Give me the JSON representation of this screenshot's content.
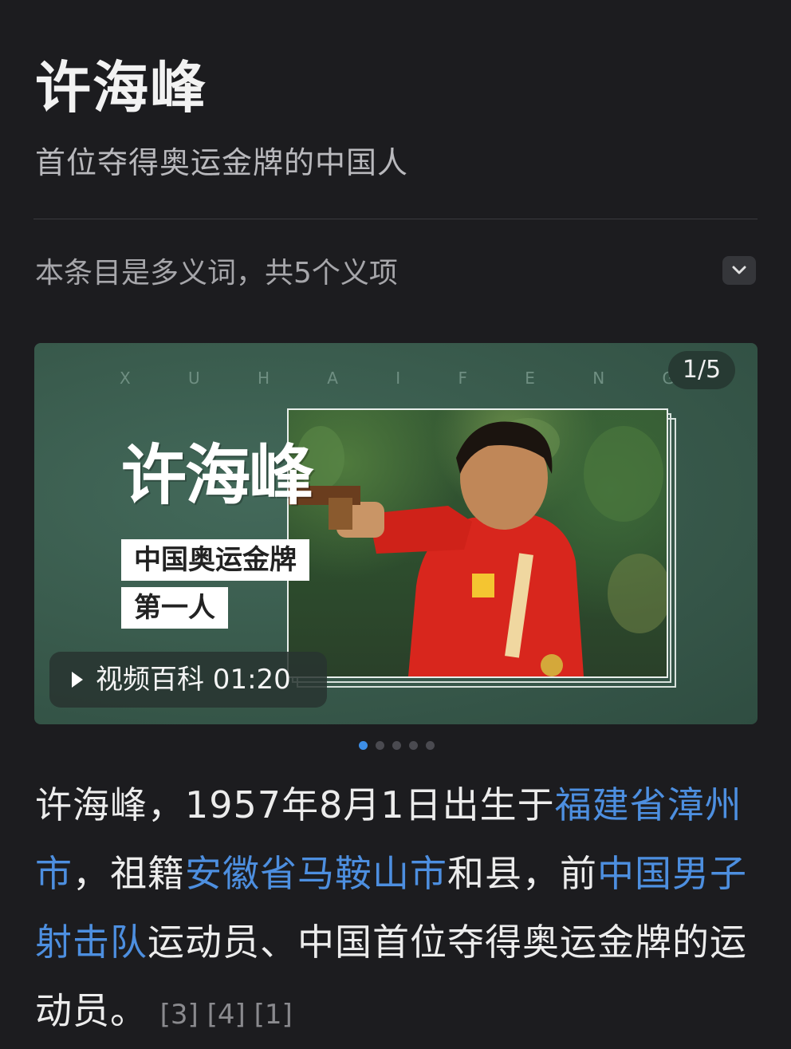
{
  "header": {
    "title": "许海峰",
    "subtitle": "首位夺得奥运金牌的中国人"
  },
  "polysemy": {
    "text": "本条目是多义词，共5个义项"
  },
  "media": {
    "letters": [
      "X",
      "U",
      "H",
      "A",
      "I",
      "F",
      "E",
      "N",
      "G"
    ],
    "counter": "1/5",
    "hero_name": "许海峰",
    "tag_line1": "中国奥运金牌",
    "tag_line2": "第一人",
    "video_label": "视频百科 01:20",
    "carousel_dots": 5,
    "active_dot": 1
  },
  "summary": {
    "t1": "许海峰，1957年8月1日出生于",
    "link1": "福建省漳州市",
    "t2": "，祖籍",
    "link2": "安徽省马鞍山市",
    "t3": "和县，前",
    "link3": "中国男子射击队",
    "t4": "运动员、中国首位夺得奥运金牌的运动员。",
    "refs": "[3] [4] [1]"
  },
  "colors": {
    "background": "#1c1c1f",
    "link": "#4d8fe0",
    "media_green": "#38594b",
    "active_dot": "#3d8ee6"
  }
}
